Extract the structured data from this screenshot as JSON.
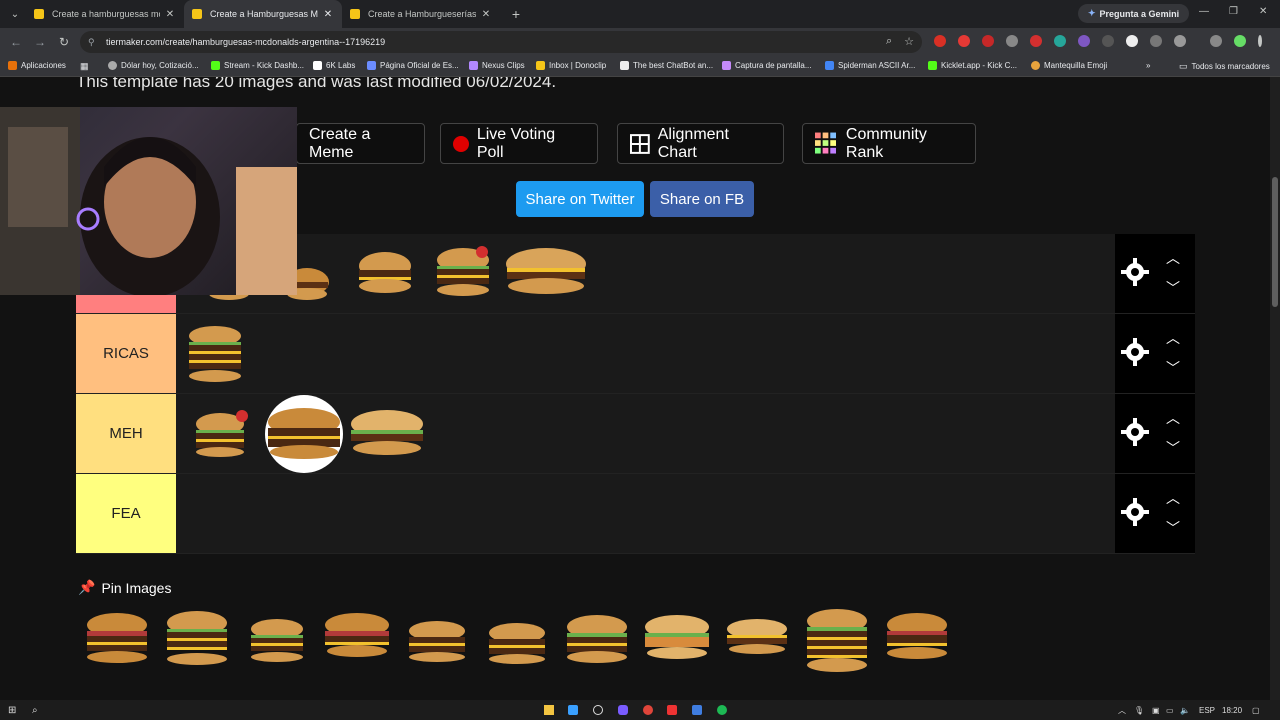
{
  "browser": {
    "tabs": [
      {
        "title": "Create a hamburguesas mostaz",
        "active": false
      },
      {
        "title": "Create a Hamburguesas Mcdon",
        "active": true
      },
      {
        "title": "Create a Hamburgueserías Arg",
        "active": false
      }
    ],
    "gemini_label": "Pregunta a Gemini",
    "url": "tiermaker.com/create/hamburguesas-mcdonalds-argentina--17196219",
    "bookmarks": [
      "Aplicaciones",
      "Dólar hoy, Cotizació...",
      "Stream - Kick Dashb...",
      "6K Labs",
      "Página Oficial de Es...",
      "Nexus Clips",
      "Inbox | Donoclip",
      "The best ChatBot an...",
      "Captura de pantalla...",
      "Spiderman ASCII Ar...",
      "Kicklet.app - Kick C...",
      "Mantequilla Emoji"
    ],
    "all_bookmarks": "Todos los marcadores"
  },
  "page": {
    "template_note": "This template has 20 images and was last modified 06/02/2024.",
    "buttons": {
      "meme": "Create a Meme",
      "poll": "Live Voting Poll",
      "alignment": "Alignment Chart",
      "community": "Community Rank",
      "twitter": "Share on Twitter",
      "fb": "Share on FB"
    },
    "tiers": [
      {
        "label": "",
        "color": "#ff7f7f"
      },
      {
        "label": "RICAS",
        "color": "#ffbf7f"
      },
      {
        "label": "MEH",
        "color": "#ffdf7f"
      },
      {
        "label": "FEA",
        "color": "#ffff7f"
      }
    ],
    "pin_label": "Pin Images"
  },
  "taskbar": {
    "lang": "ESP",
    "time": "18:20"
  }
}
